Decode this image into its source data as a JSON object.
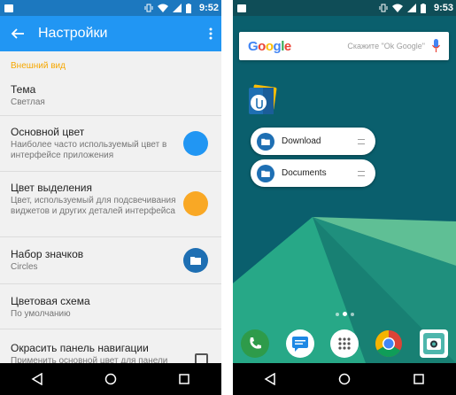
{
  "left": {
    "status_time": "9:52",
    "toolbar_title": "Настройки",
    "section_header": "Внешний вид",
    "settings": [
      {
        "title": "Тема",
        "subtitle": "Светлая"
      },
      {
        "title": "Основной цвет",
        "subtitle": "Наиболее часто используемый цвет в интерфейсе приложения",
        "color": "#2196f3"
      },
      {
        "title": "Цвет выделения",
        "subtitle": "Цвет, используемый для подсвечивания виджетов и других деталей интерфейса",
        "color": "#f9a825"
      },
      {
        "title": "Набор значков",
        "subtitle": "Circles",
        "color": "#1e6fb3"
      },
      {
        "title": "Цветовая схема",
        "subtitle": "По умолчанию"
      },
      {
        "title": "Окрасить панель навигации",
        "subtitle": "Применить основной цвет для панели",
        "checked": false
      }
    ]
  },
  "right": {
    "status_time": "9:53",
    "search_hint": "Скажите \"Ok Google\"",
    "shortcuts": [
      {
        "label": "Download"
      },
      {
        "label": "Documents"
      }
    ],
    "dock": [
      "phone-icon",
      "messages-icon",
      "app-drawer-icon",
      "chrome-icon",
      "camera-icon"
    ]
  },
  "colors": {
    "primary": "#2196f3",
    "accent": "#f9a825",
    "section_header": "#f6a700"
  }
}
